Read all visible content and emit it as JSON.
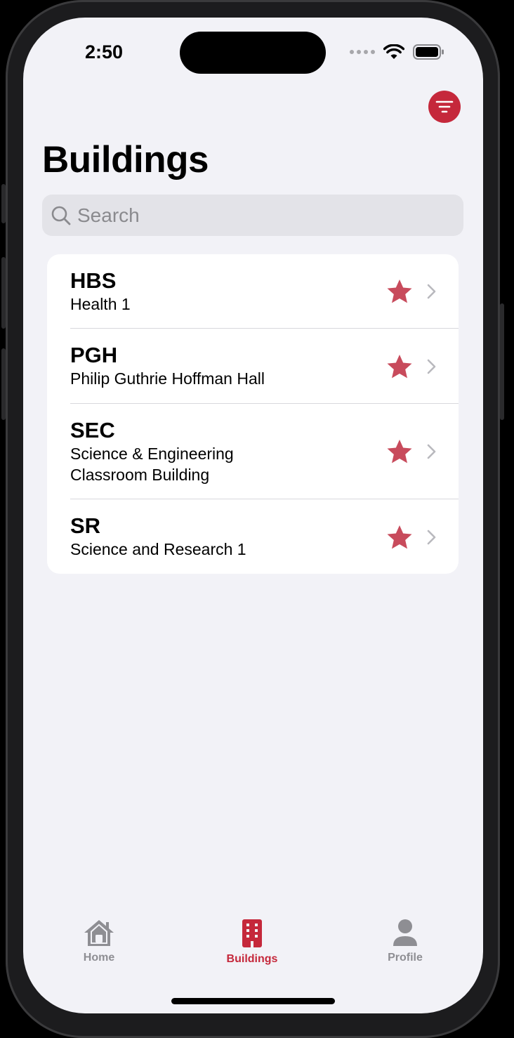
{
  "status_bar": {
    "time": "2:50"
  },
  "header": {
    "title": "Buildings",
    "filter_icon": "filter-lines-icon"
  },
  "search": {
    "placeholder": "Search",
    "value": ""
  },
  "buildings": [
    {
      "code": "HBS",
      "name": "Health 1",
      "favorite": true
    },
    {
      "code": "PGH",
      "name": "Philip Guthrie Hoffman Hall",
      "favorite": true
    },
    {
      "code": "SEC",
      "name_line1": "Science & Engineering",
      "name_line2": "Classroom Building",
      "favorite": true
    },
    {
      "code": "SR",
      "name": "Science and Research 1",
      "favorite": true
    }
  ],
  "tab_bar": {
    "tabs": [
      {
        "label": "Home",
        "icon": "house-icon",
        "selected": false
      },
      {
        "label": "Buildings",
        "icon": "building-icon",
        "selected": true
      },
      {
        "label": "Profile",
        "icon": "person-icon",
        "selected": false
      }
    ]
  },
  "colors": {
    "accent": "#c5283b",
    "star": "#c84b5c",
    "inactive_tab": "#8e8e93",
    "background": "#f2f2f7"
  }
}
